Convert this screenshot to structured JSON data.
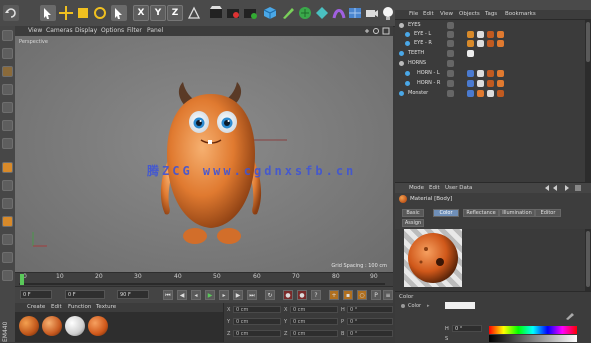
{
  "viewport": {
    "menu": [
      "View",
      "Cameras",
      "Display",
      "Options",
      "Filter",
      "Panel"
    ],
    "label": "Perspective",
    "grid_spacing": "Grid Spacing : 100 cm",
    "watermark": "腾ZCG  www.cgdnxsfb.cn"
  },
  "timeline": {
    "ticks": [
      "0",
      "10",
      "20",
      "30",
      "40",
      "50",
      "60",
      "70",
      "80",
      "90"
    ],
    "start_field": "0 F",
    "current_field": "0 F",
    "end_field": "90 F",
    "end_field_2": "90 F"
  },
  "material_manager": {
    "menu": [
      "Create",
      "Edit",
      "Function",
      "Texture"
    ]
  },
  "coordinates": {
    "rows": [
      {
        "axis": "X",
        "value": "0 cm",
        "axis2": "X",
        "value2": "0 cm",
        "axis3": "H",
        "value3": "0 °"
      },
      {
        "axis": "Y",
        "value": "0 cm",
        "axis2": "Y",
        "value2": "0 cm",
        "axis3": "P",
        "value3": "0 °"
      },
      {
        "axis": "Z",
        "value": "0 cm",
        "axis2": "Z",
        "value2": "0 cm",
        "axis3": "B",
        "value3": "0 °"
      }
    ]
  },
  "object_manager": {
    "menu": [
      "File",
      "Edit",
      "View",
      "Objects",
      "Tags",
      "Bookmarks"
    ],
    "objects": [
      {
        "name": "EYES",
        "indent": 0
      },
      {
        "name": "EYE - L",
        "indent": 1
      },
      {
        "name": "EYE - R",
        "indent": 1
      },
      {
        "name": "TEETH",
        "indent": 0
      },
      {
        "name": "HORNS",
        "indent": 0
      },
      {
        "name": "HORN - L",
        "indent": 1
      },
      {
        "name": "HORN - R",
        "indent": 1
      },
      {
        "name": "Monster",
        "indent": 0
      }
    ]
  },
  "attribute_manager": {
    "menu": [
      "Mode",
      "Edit",
      "User Data"
    ],
    "title": "Material [Body]",
    "tabs": [
      "Basic",
      "Color",
      "Reflectance",
      "Illumination",
      "Editor",
      "Assign"
    ],
    "active_tab": "Color",
    "section": "Color",
    "color_label": "Color",
    "h_label": "H",
    "h_value": "0 °",
    "s_label": "S"
  },
  "left_toolbar": {
    "vertical_text": "ЕМ440"
  },
  "colors": {
    "accent": "#6f8fb8",
    "body_orange": "#e07a30",
    "watermark": "#3f55d6",
    "timeline_head": "#5ac85a"
  }
}
